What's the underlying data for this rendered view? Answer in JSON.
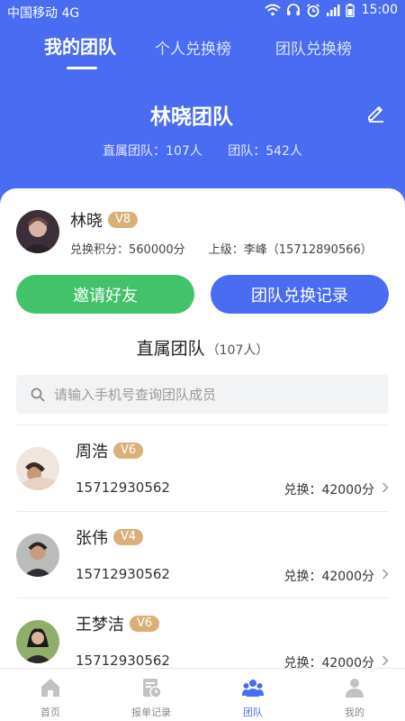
{
  "status_bar": {
    "carrier": "中国移动 4G",
    "time": "15:00"
  },
  "tabs": [
    {
      "label": "我的团队",
      "active": true
    },
    {
      "label": "个人兑换榜",
      "active": false
    },
    {
      "label": "团队兑换榜",
      "active": false
    }
  ],
  "team": {
    "title": "林晓团队",
    "direct_stat": "直属团队：107人",
    "total_stat": "团队：542人"
  },
  "me": {
    "name": "林晓",
    "level": "V8",
    "points": "兑换积分：560000分",
    "superior": "上级：李峰（15712890566）"
  },
  "actions": {
    "invite": "邀请好友",
    "records": "团队兑换记录"
  },
  "section": {
    "title": "直属团队",
    "count": "（107人）"
  },
  "search": {
    "placeholder": "请输入手机号查询团队成员",
    "value": ""
  },
  "members": [
    {
      "name": "周浩",
      "level": "V6",
      "phone": "15712930562",
      "points": "兑换：42000分"
    },
    {
      "name": "张伟",
      "level": "V4",
      "phone": "15712930562",
      "points": "兑换：42000分"
    },
    {
      "name": "王梦洁",
      "level": "V6",
      "phone": "15712930562",
      "points": "兑换：42000分"
    }
  ],
  "bottom_nav": [
    {
      "label": "首页",
      "icon": "home-icon",
      "active": false
    },
    {
      "label": "报单记录",
      "icon": "record-icon",
      "active": false
    },
    {
      "label": "团队",
      "icon": "team-icon",
      "active": true
    },
    {
      "label": "我的",
      "icon": "user-icon",
      "active": false
    }
  ],
  "colors": {
    "primary": "#4a6cf2",
    "green": "#43c26c",
    "badge": "#d8b078"
  }
}
